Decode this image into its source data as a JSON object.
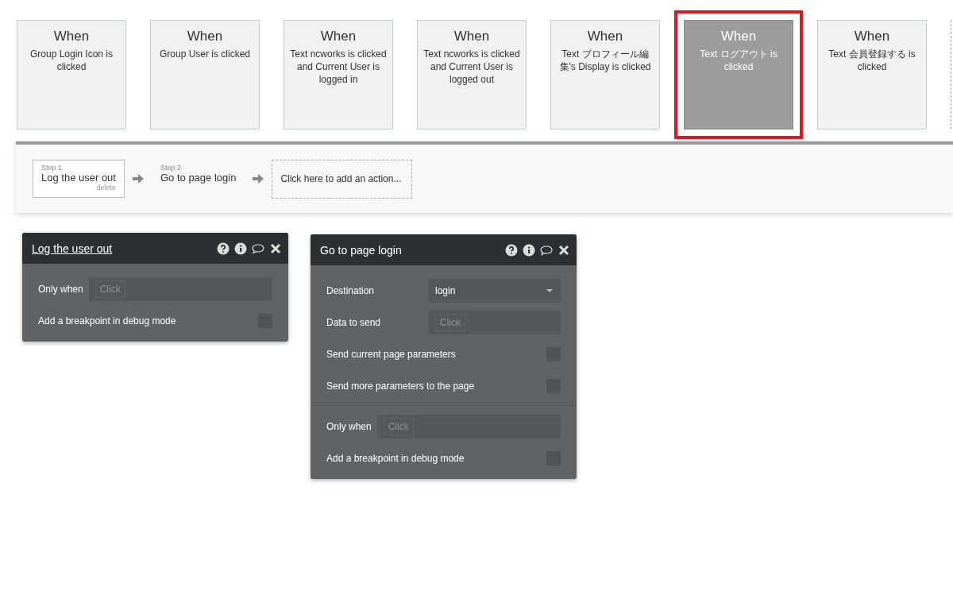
{
  "events": [
    {
      "heading": "When",
      "text": "Group Login Icon is clicked",
      "selected": false
    },
    {
      "heading": "When",
      "text": "Group User is clicked",
      "selected": false
    },
    {
      "heading": "When",
      "text": "Text ncworks is clicked and Current User is logged in",
      "selected": false
    },
    {
      "heading": "When",
      "text": "Text ncworks is clicked and Current User is logged out",
      "selected": false
    },
    {
      "heading": "When",
      "text": "Text プロフィール編集's Display is clicked",
      "selected": false
    },
    {
      "heading": "When",
      "text": "Text ログアウト is clicked",
      "selected": true
    },
    {
      "heading": "When",
      "text": "Text 会員登録する is clicked",
      "selected": false
    }
  ],
  "steps": [
    {
      "step": "Step 1",
      "action": "Log the user out",
      "delete": "delete",
      "selected": true
    },
    {
      "step": "Step 2",
      "action": "Go to page login",
      "selected": false
    }
  ],
  "add_action": "Click here to add an action...",
  "panels": [
    {
      "title": "Log the user out",
      "title_underlined": true,
      "rows": [
        {
          "kind": "condition",
          "label": "Only when",
          "placeholder": "Click"
        },
        {
          "kind": "checkbox",
          "label": "Add a breakpoint in debug mode",
          "checked": false
        }
      ]
    },
    {
      "title": "Go to page login",
      "title_underlined": false,
      "rows": [
        {
          "kind": "dropdown",
          "label": "Destination",
          "value": "login"
        },
        {
          "kind": "field",
          "label": "Data to send",
          "placeholder": "Click"
        },
        {
          "kind": "checkbox",
          "label": "Send current page parameters",
          "checked": false
        },
        {
          "kind": "checkbox",
          "label": "Send more parameters to the page",
          "checked": false
        },
        {
          "kind": "divider"
        },
        {
          "kind": "condition",
          "label": "Only when",
          "placeholder": "Click"
        },
        {
          "kind": "checkbox",
          "label": "Add a breakpoint in debug mode",
          "checked": false
        }
      ]
    }
  ]
}
